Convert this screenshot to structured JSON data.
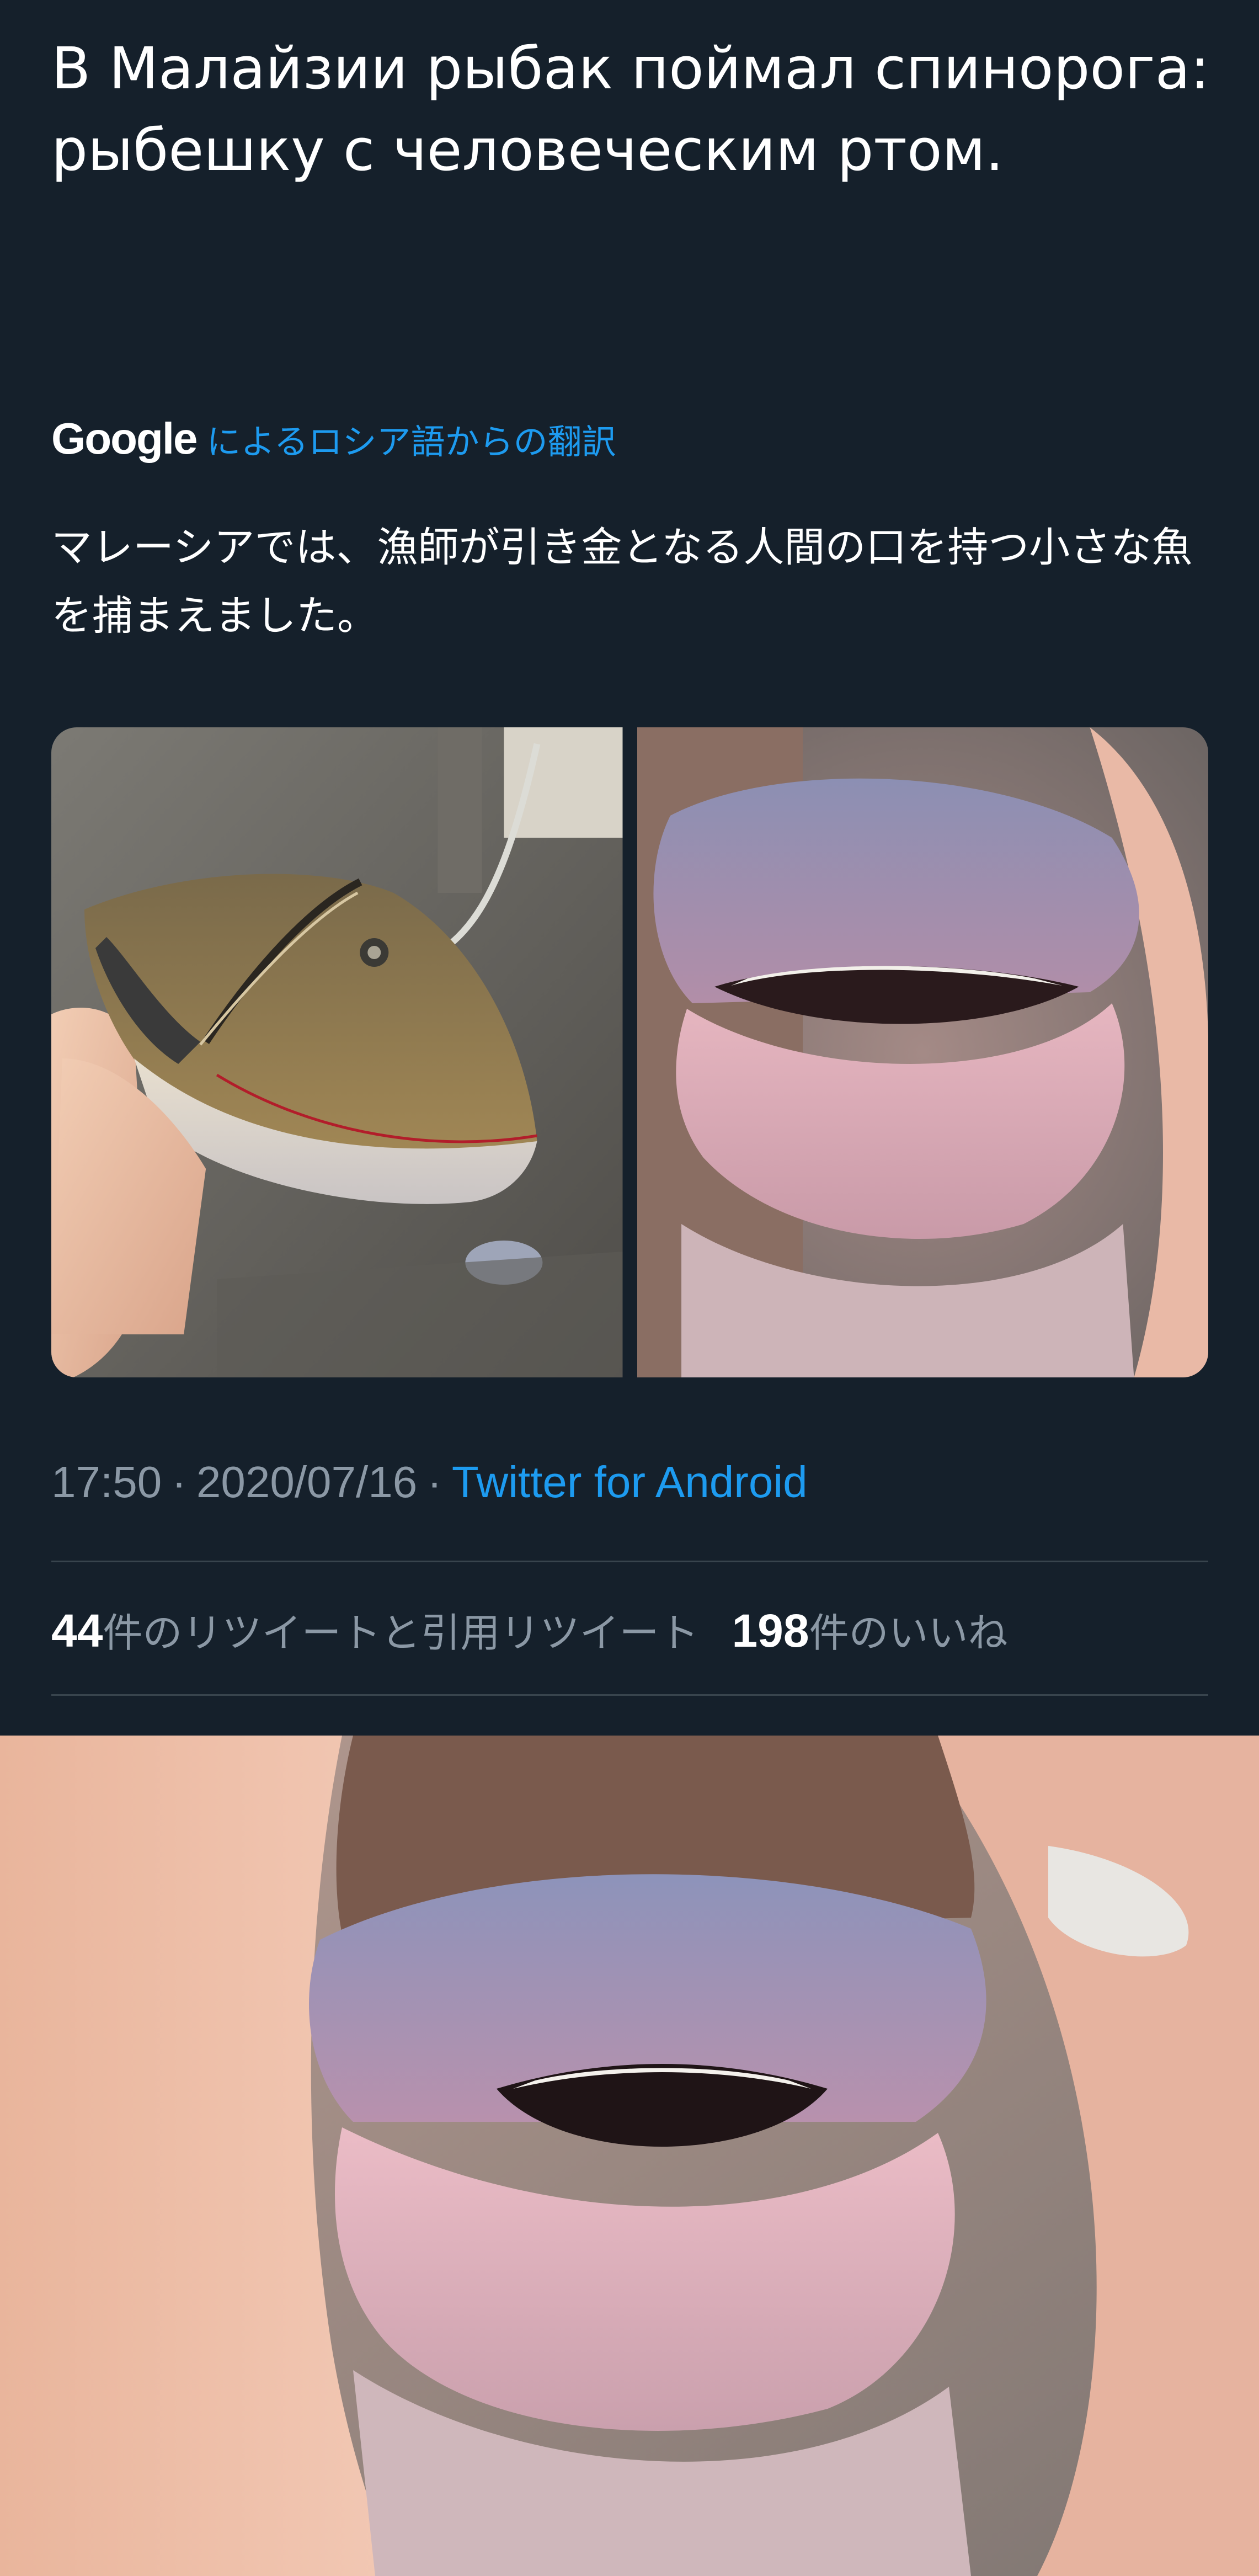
{
  "tweet": {
    "text": "В Малайзии рыбак поймал спинорога: рыбешку с человеческим ртом.",
    "translation": {
      "provider": "Google",
      "link_label": "によるロシア語からの翻訳",
      "text": "マレーシアでは、漁師が引き金となる人間の口を持つ小さな魚を捕まえました。"
    },
    "meta": {
      "time": "17:50",
      "separator": "·",
      "date": "2020/07/16",
      "source": "Twitter for Android"
    },
    "stats": {
      "retweets_count": "44",
      "retweets_label": "件のリツイートと引用リツイート",
      "likes_count": "198",
      "likes_label": "件のいいね"
    }
  },
  "colors": {
    "background": "#15202b",
    "link": "#1d9bf0",
    "muted": "#8b98a5",
    "divider": "#38444d"
  }
}
